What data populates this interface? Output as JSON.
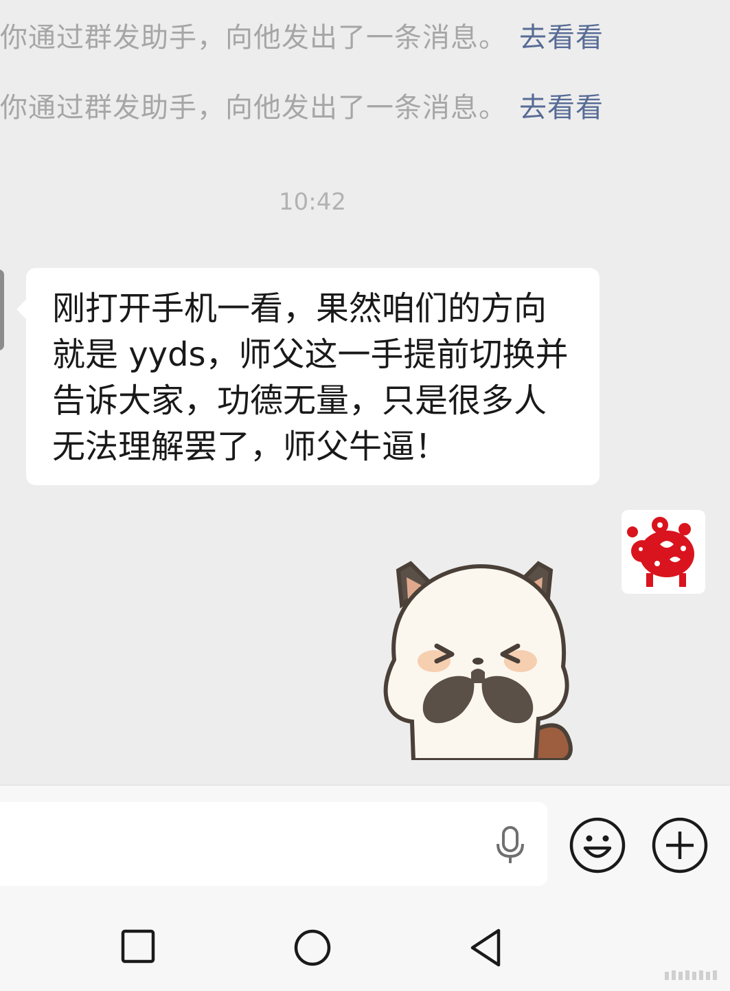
{
  "system_messages": [
    {
      "text": "你通过群发助手，向他发出了一条消息。",
      "link": "去看看"
    },
    {
      "text": "你通过群发助手，向他发出了一条消息。",
      "link": "去看看"
    }
  ],
  "timestamp": "10:42",
  "incoming_message": {
    "text": "刚打开手机一看，果然咱们的方向就是 yyds，师父这一手提前切换并告诉大家，功德无量，只是很多人无法理解罢了，师父牛逼！"
  },
  "outgoing_message": {
    "type": "sticker",
    "sticker_name": "raccoon-covering-face-laughing"
  },
  "composer": {
    "voice_icon": "microphone-icon",
    "emoji_icon": "smiley-icon",
    "more_icon": "plus-circle-icon"
  },
  "nav": {
    "recent_icon": "square-icon",
    "home_icon": "circle-icon",
    "back_icon": "triangle-back-icon"
  },
  "colors": {
    "background": "#ededed",
    "link": "#576b95",
    "system_text": "#a6a6a6",
    "bubble": "#ffffff",
    "paper_cut_red": "#d9141e"
  }
}
